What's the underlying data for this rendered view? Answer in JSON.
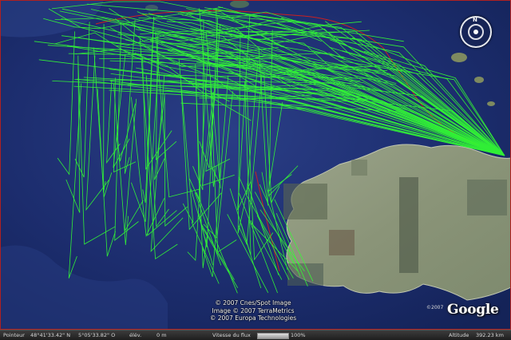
{
  "map": {
    "credits": [
      "© 2007 Cnes/Spot Image",
      "Image © 2007 TerraMetrics",
      "© 2007 Europa Technologies"
    ],
    "logo": "Google",
    "logo_copyright": "©2007",
    "compass": {
      "north_label": "N"
    },
    "colors": {
      "ocean": "#1b2d6b",
      "tracks": "#33ff33",
      "route": "#cc2020",
      "land": "#8f9a7a"
    }
  },
  "statusbar": {
    "pointer_label": "Pointeur",
    "pointer_lat": "48°41'33.42\" N",
    "pointer_lon": "5°05'33.82\" O",
    "elev_label": "élév.",
    "elev_value": "0 m",
    "stream_label": "Vitesse du flux",
    "stream_percent": "100%",
    "stream_fraction": 1.0,
    "altitude_label": "Altitude",
    "altitude_value": "392.23 km"
  }
}
